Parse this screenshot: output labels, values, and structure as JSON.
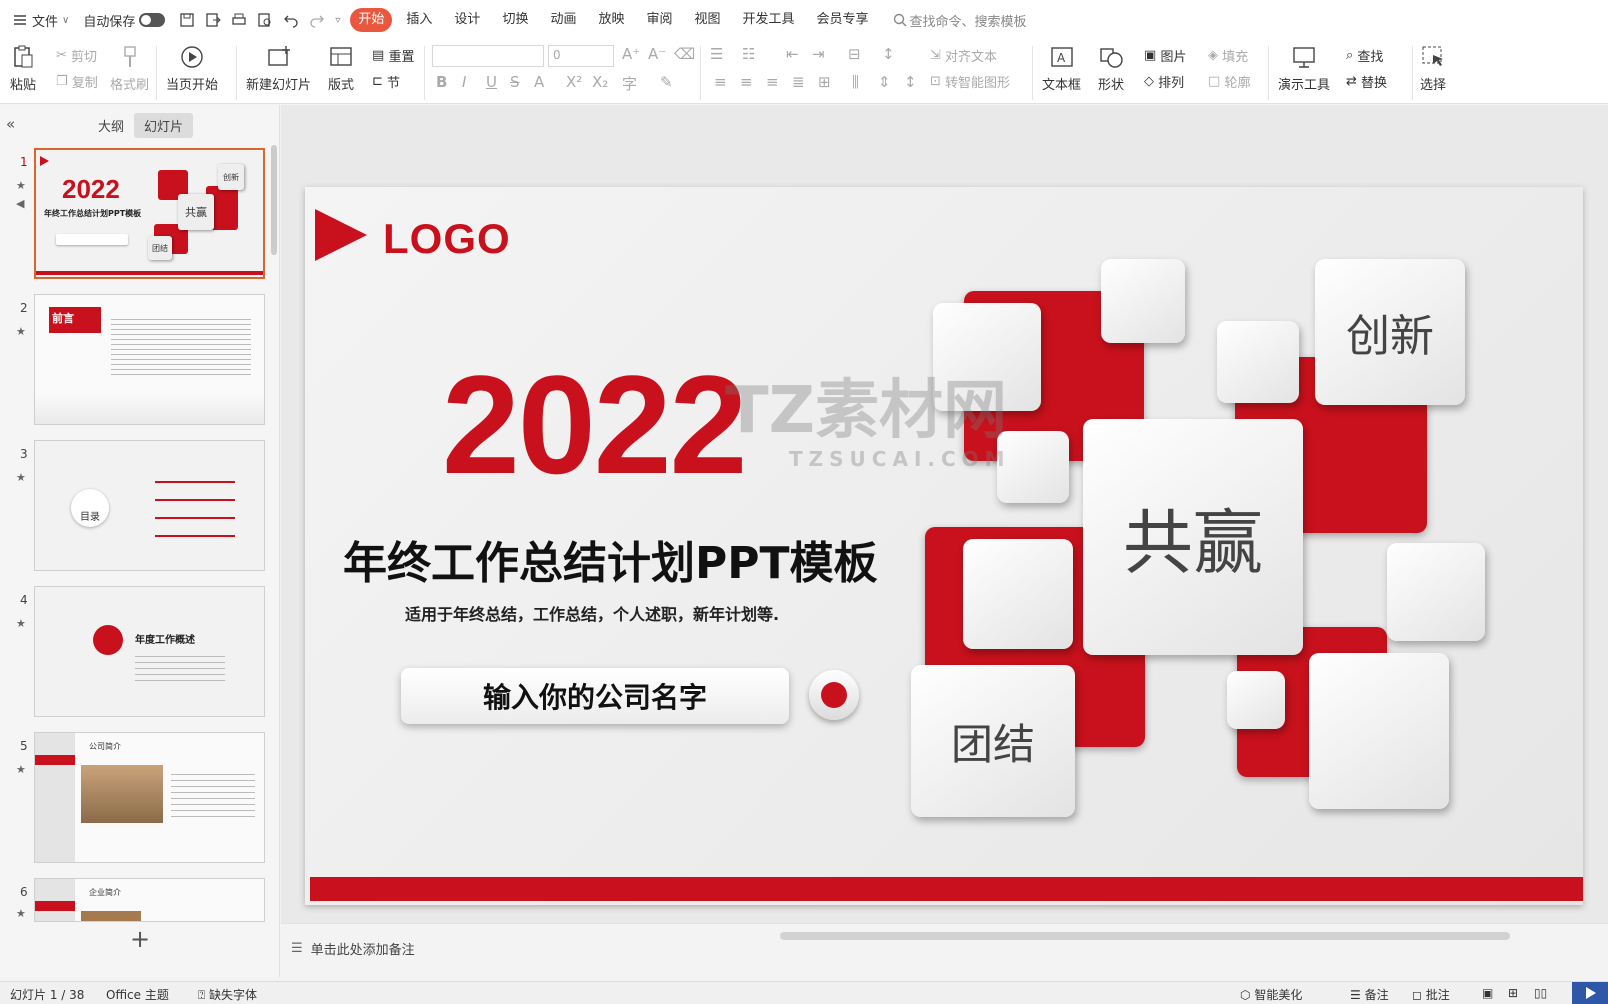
{
  "menubar": {
    "file": "文件",
    "autosave": "自动保存",
    "tabs": [
      "开始",
      "插入",
      "设计",
      "切换",
      "动画",
      "放映",
      "审阅",
      "视图",
      "开发工具",
      "会员专享"
    ],
    "search_placeholder": "查找命令、搜索模板"
  },
  "ribbon": {
    "paste": "粘贴",
    "cut": "剪切",
    "copy": "复制",
    "format_painter": "格式刷",
    "from_current": "当页开始",
    "new_slide": "新建幻灯片",
    "layout": "版式",
    "reset": "重置",
    "section": "节",
    "font_size": "0",
    "align_text": "对齐文本",
    "to_smartart": "转智能图形",
    "textbox": "文本框",
    "shape": "形状",
    "picture": "图片",
    "fill": "填充",
    "arrange": "排列",
    "outline": "轮廓",
    "present_tools": "演示工具",
    "find": "查找",
    "replace": "替换",
    "select": "选择"
  },
  "left_panel": {
    "tab_outline": "大纲",
    "tab_slides": "幻灯片",
    "thumbs": [
      {
        "num": "1",
        "text": "年终工作总结计划PPT模板"
      },
      {
        "num": "2",
        "text": "前言"
      },
      {
        "num": "3",
        "text": "目录"
      },
      {
        "num": "4",
        "text": "年度工作概述"
      },
      {
        "num": "5",
        "text": "公司简介"
      },
      {
        "num": "6",
        "text": "企业简介"
      }
    ]
  },
  "slide": {
    "logo": "LOGO",
    "year": "2022",
    "title": "年终工作总结计划PPT模板",
    "subtitle": "适用于年终总结，工作总结，个人述职，新年计划等.",
    "company": "输入你的公司名字",
    "tile_innovate": "创新",
    "tile_win": "共赢",
    "tile_unite": "团结",
    "watermark_cn": "TZ素材网",
    "watermark_en": "TZSUCAI.COM"
  },
  "notes": {
    "placeholder": "单击此处添加备注"
  },
  "status": {
    "slide_count": "幻灯片 1 / 38",
    "theme": "Office 主题",
    "missing_font": "缺失字体",
    "beautify": "智能美化",
    "notes": "备注",
    "comments": "批注"
  },
  "colors": {
    "accent": "#c8111c",
    "tab_active": "#e9573f"
  }
}
